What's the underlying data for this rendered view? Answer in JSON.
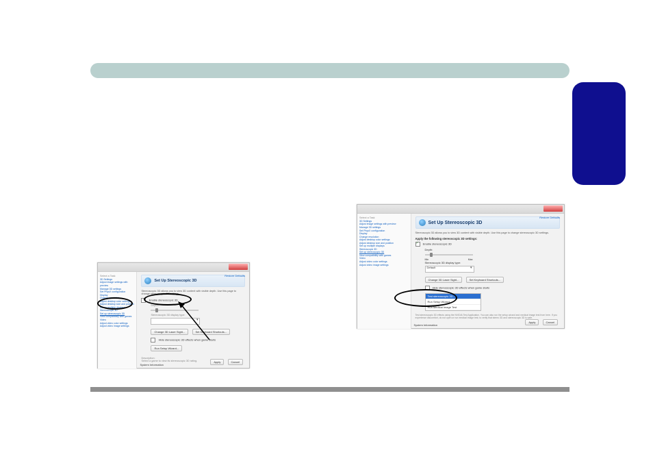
{
  "ss1": {
    "title": "Set Up Stereoscopic 3D",
    "subtitle": "Stereoscopic 3D allows you to view 3D content with visible depth. Use this page to change stereoscopic 3D settings.",
    "sidebar": {
      "task_label": "Select a Task",
      "group1": "3D Settings",
      "items1": [
        "Adjust image settings with preview",
        "Manage 3D settings",
        "Set PhysX configuration"
      ],
      "group2": "Display",
      "items2": [
        "Change resolution",
        "Adjust desktop color settings",
        "Adjust desktop size and position",
        "Set up multiple displays"
      ],
      "group3": "Stereoscopic 3D",
      "items3": [
        "Set up stereoscopic 3D",
        "View compatibility with games"
      ],
      "group4": "Video",
      "items4": [
        "Adjust video color settings",
        "Adjust video image settings"
      ]
    },
    "checkbox_label": "Enable stereoscopic 3D",
    "depth_label": "Depth:",
    "display_type_label": "Stereoscopic 3D display type:",
    "btn_change": "Change 3D Laser Sight...",
    "btn_keyboard": "Set Keyboard Shortcuts...",
    "hide_label": "Hide stereoscopic 3D effects when game starts",
    "run_wizard": "Run Setup Wizard...",
    "desc_label": "Description:",
    "desc_placeholder": "Select a game to view its stereoscopic 3D rating.",
    "restore_link": "Restore Defaults",
    "sys_info": "System Information",
    "apply": "Apply",
    "cancel": "Cancel"
  },
  "ss2": {
    "title": "Set Up Stereoscopic 3D",
    "subtitle": "Stereoscopic 3D allows you to view 3D content with visible depth. Use this page to change stereoscopic 3D settings.",
    "apply_label": "Apply the following stereoscopic 3D settings:",
    "checkbox_label": "Enable stereoscopic 3D",
    "depth_label": "Depth:",
    "depth_min": "Min",
    "depth_max": "Max",
    "display_type_label": "Stereoscopic 3D display type:",
    "display_type_value": "Default",
    "btn_change": "Change 3D Laser Sight...",
    "btn_keyboard": "Set Keyboard Shortcuts...",
    "hide_label": "Hide stereoscopic 3D effects when game starts",
    "list": {
      "items": [
        "Test stereoscopic 3D...",
        "Run Setup Wizard",
        "Run Medical Image Test"
      ]
    },
    "footnote": "Test stereoscopic 3D effects using the NVIDIA Test Application. You can also run the setup wizard and medical image test from here. If you experience discomfort, do not open or run medical image test; to verify that stereo 3D and stereoscopic 3D is safe.",
    "restore_link": "Restore Defaults",
    "sys_info": "System Information",
    "apply": "Apply",
    "cancel": "Cancel",
    "sidebar": {
      "task_label": "Select a Task",
      "group1": "3D Settings",
      "items1": [
        "Adjust image settings with preview",
        "Manage 3D settings",
        "Set PhysX configuration"
      ],
      "group2": "Display",
      "items2": [
        "Change resolution",
        "Adjust desktop color settings",
        "Adjust desktop size and position",
        "Set up multiple displays"
      ],
      "group3": "Stereoscopic 3D",
      "items3": [
        "Set up stereoscopic 3D",
        "View compatibility with games"
      ],
      "group4": "Video",
      "items4": [
        "Adjust video color settings",
        "Adjust video image settings"
      ]
    }
  }
}
